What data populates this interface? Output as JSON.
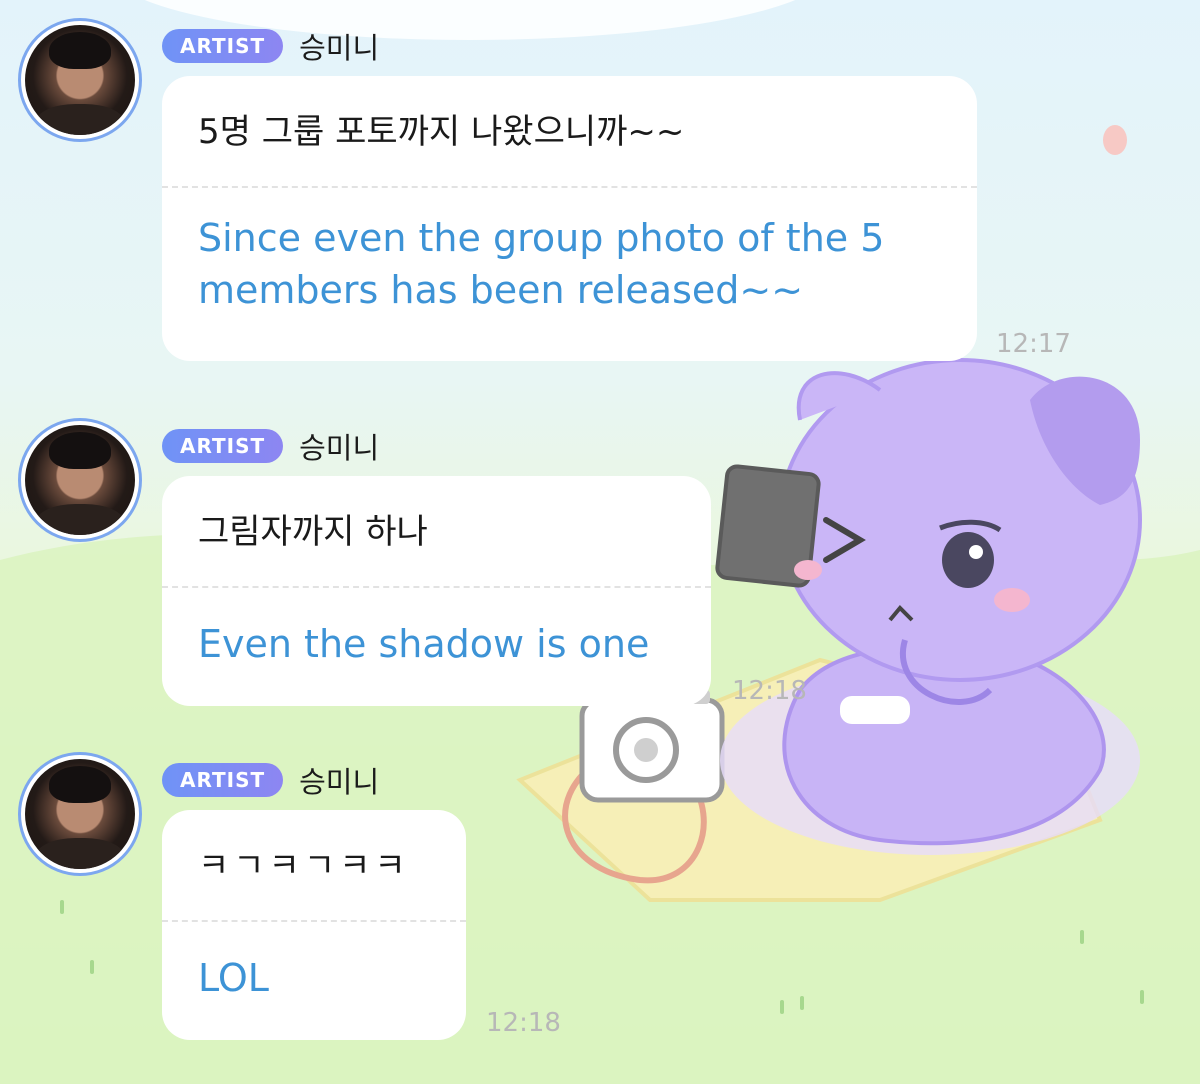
{
  "messages": [
    {
      "badge": "ARTIST",
      "sender": "승미니",
      "original": "5명 그룹 포토까지 나왔으니까~~",
      "translation": "Since even the group photo of the 5 members has been released~~",
      "time": "12:17"
    },
    {
      "badge": "ARTIST",
      "sender": "승미니",
      "original": "그림자까지 하나",
      "translation": "Even the shadow is one",
      "time": "12:18"
    },
    {
      "badge": "ARTIST",
      "sender": "승미니",
      "original": "ㅋㄱㅋㄱㅋㅋ",
      "translation": "LOL",
      "time": "12:18"
    }
  ],
  "colors": {
    "badge_gradient_start": "#6f93f6",
    "badge_gradient_end": "#8d86f2",
    "translation_text": "#3d93d6",
    "timestamp": "#b7b7b7",
    "avatar_ring": "#7ca7ef"
  },
  "background": {
    "sticker_icon": "purple-cat-with-phone-icon",
    "camera_icon": "camera-icon"
  }
}
